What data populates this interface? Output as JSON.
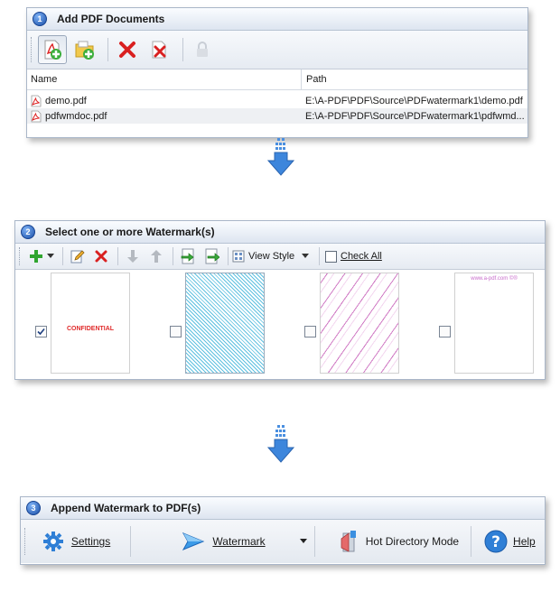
{
  "step1": {
    "badge": "1",
    "title": "Add PDF Documents",
    "toolbar": {
      "buttons": [
        {
          "icon": "add-pdf-icon"
        },
        {
          "icon": "add-folder-icon"
        },
        {
          "icon": "remove-icon"
        },
        {
          "icon": "remove-all-icon"
        },
        {
          "icon": "lock-icon"
        }
      ]
    },
    "columns": {
      "name": "Name",
      "path": "Path"
    },
    "files": [
      {
        "name": "demo.pdf",
        "path": "E:\\A-PDF\\PDF\\Source\\PDFwatermark1\\demo.pdf"
      },
      {
        "name": "pdfwmdoc.pdf",
        "path": "E:\\A-PDF\\PDF\\Source\\PDFwatermark1\\pdfwmd..."
      }
    ]
  },
  "step2": {
    "badge": "2",
    "title": "Select one or more Watermark(s)",
    "view_style_label": "View Style",
    "check_all_label": "Check All",
    "thumbnails": [
      {
        "checked": true,
        "text": "CONFIDENTIAL"
      },
      {
        "checked": false
      },
      {
        "checked": false
      },
      {
        "checked": false,
        "text": "www.a-pdf.com ©®"
      }
    ]
  },
  "step3": {
    "badge": "3",
    "title": "Append Watermark to PDF(s)",
    "settings_label": "Settings",
    "watermark_label": "Watermark",
    "hotdir_label": "Hot Directory Mode",
    "help_label": "Help"
  },
  "colors": {
    "accent_blue": "#1a4fa8",
    "red_x": "#d92020",
    "green_plus": "#2fa52f"
  }
}
